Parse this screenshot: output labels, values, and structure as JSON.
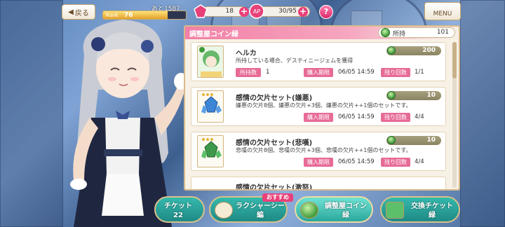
{
  "hud": {
    "back_label": "戻る",
    "rank_next": "あと1587",
    "rank_label": "Rank",
    "rank_value": "76",
    "rank_progress": 0.78,
    "gems": "18",
    "ap": "30/95",
    "help_label": "?",
    "menu_label": "MENU"
  },
  "panel": {
    "title": "調整屋コイン緑",
    "owned_label": "所持",
    "owned_value": "101"
  },
  "items": [
    {
      "name": "ヘルカ",
      "desc": "所持している場合、デスティニージェムを獲得",
      "price": "200",
      "owned_label": "所持数",
      "owned": "1",
      "period_label": "購入期限",
      "period": "06/05 14:59",
      "remain_label": "残り回数",
      "remain": "1/1",
      "thumb": "character-portrait"
    },
    {
      "name": "感情の欠片セット(嫌悪)",
      "desc": "嫌悪の欠片8個、嫌悪の欠片+3個、嫌悪の欠片++1個のセットです。",
      "price": "10",
      "period_label": "購入期限",
      "period": "06/05 14:59",
      "remain_label": "残り回数",
      "remain": "4/4",
      "thumb": "blue-crystal"
    },
    {
      "name": "感情の欠片セット(悲嘆)",
      "desc": "悲嘆の欠片8個、悲嘆の欠片+3個、悲嘆の欠片++1個のセットです。",
      "price": "10",
      "period_label": "購入期限",
      "period": "06/05 14:59",
      "remain_label": "残り回数",
      "remain": "4/4",
      "thumb": "green-crystal"
    },
    {
      "name": "感情の欠片セット(激怒)"
    }
  ],
  "tabs": [
    {
      "line1": "チケット",
      "line2": "22"
    },
    {
      "line1": "ラクシャーシー",
      "line2": "編",
      "badge": "おすすめ"
    },
    {
      "line1": "調整屋コイン",
      "line2": "緑"
    },
    {
      "line1": "交換チケット",
      "line2": "緑"
    }
  ],
  "colors": {
    "accent_pink": "#e8417a",
    "tab_teal": "#1f8a85",
    "coin_green": "#3f9a3a",
    "panel_bg": "#f7f1e6"
  }
}
